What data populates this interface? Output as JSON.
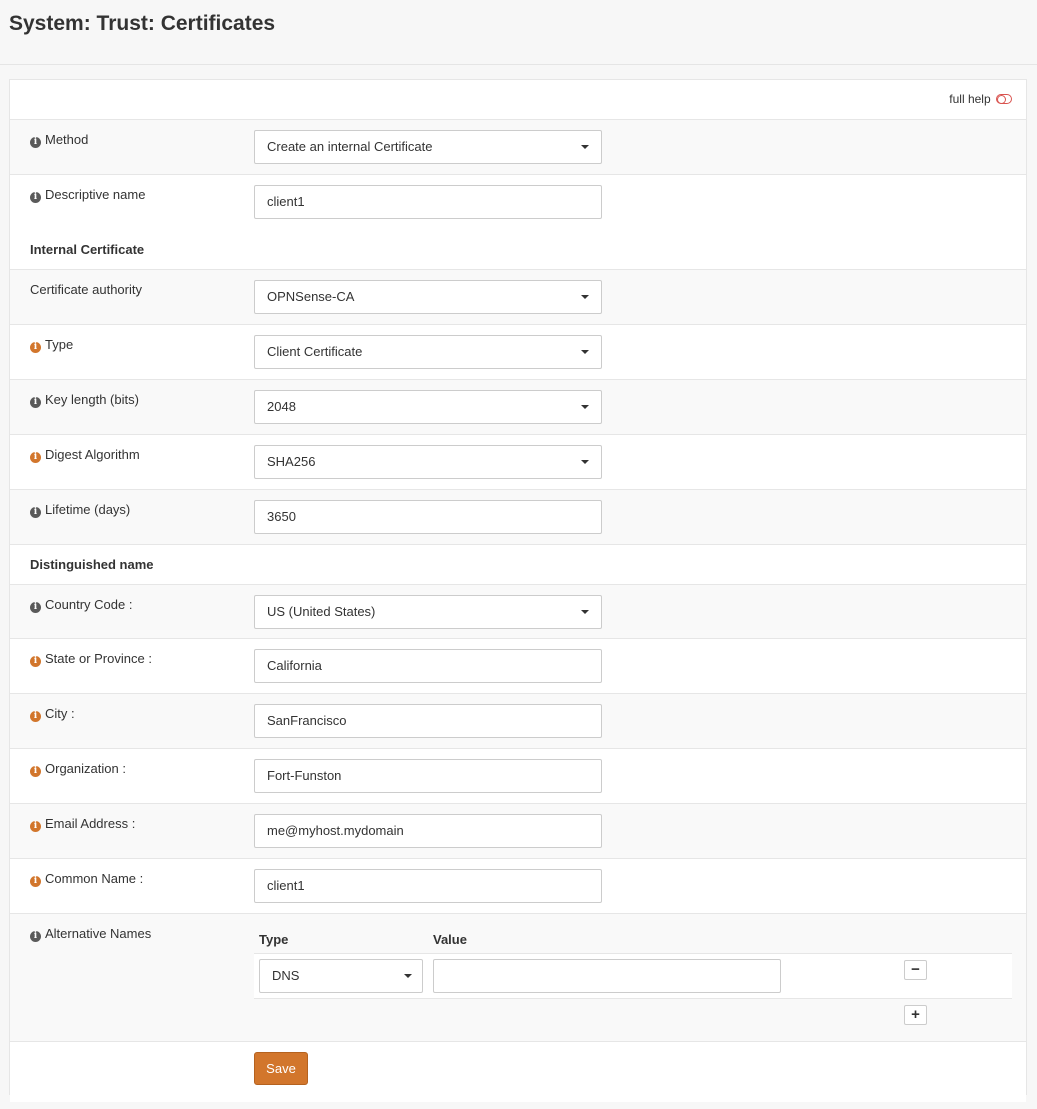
{
  "page_title": "System: Trust: Certificates",
  "help": {
    "label": "full help"
  },
  "fields": {
    "method": {
      "label": "Method",
      "value": "Create an internal Certificate"
    },
    "descr": {
      "label": "Descriptive name",
      "value": "client1"
    },
    "internal_section": "Internal Certificate",
    "ca": {
      "label": "Certificate authority",
      "value": "OPNSense-CA"
    },
    "type": {
      "label": "Type",
      "value": "Client Certificate"
    },
    "keylen": {
      "label": "Key length (bits)",
      "value": "2048"
    },
    "digest": {
      "label": "Digest Algorithm",
      "value": "SHA256"
    },
    "lifetime": {
      "label": "Lifetime (days)",
      "value": "3650"
    },
    "dn_section": "Distinguished name",
    "country": {
      "label": "Country Code :",
      "value": "US (United States)"
    },
    "state": {
      "label": "State or Province :",
      "value": "California"
    },
    "city": {
      "label": "City :",
      "value": "SanFrancisco"
    },
    "org": {
      "label": "Organization :",
      "value": "Fort-Funston"
    },
    "email": {
      "label": "Email Address :",
      "value": "me@myhost.mydomain"
    },
    "cn": {
      "label": "Common Name :",
      "value": "client1"
    },
    "altnames": {
      "label": "Alternative Names",
      "col_type": "Type",
      "col_value": "Value",
      "row_type": "DNS",
      "row_value": ""
    }
  },
  "save_label": "Save",
  "icons": {
    "info": "info-circle",
    "remove": "minus",
    "add": "plus"
  },
  "colors": {
    "accent": "#d2762c",
    "toggle": "#d9534f"
  }
}
